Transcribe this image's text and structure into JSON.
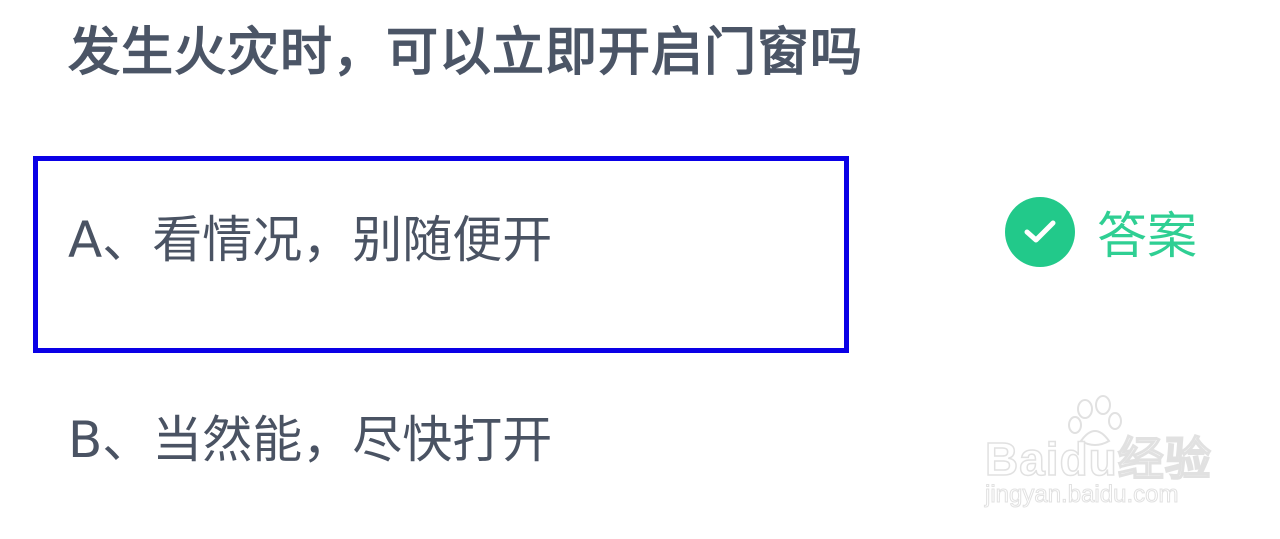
{
  "question": {
    "text": "发生火灾时，可以立即开启门窗吗"
  },
  "options": [
    {
      "text": "A、看情况，别随便开",
      "selected": true
    },
    {
      "text": "B、当然能，尽快打开",
      "selected": false
    }
  ],
  "answer": {
    "label": "答案",
    "icon": "check-icon",
    "color": "#22c98a"
  },
  "highlight": {
    "color": "#0a00e6"
  },
  "watermark": {
    "brand": "Baidu经验",
    "url": "jingyan.baidu.com"
  }
}
